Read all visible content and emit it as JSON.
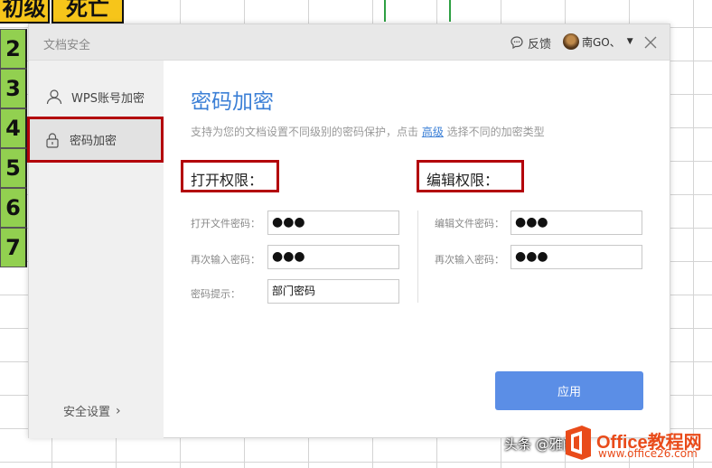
{
  "sheet": {
    "top_cells": [
      "初级",
      "死亡"
    ],
    "row_numbers": [
      "2",
      "3",
      "4",
      "5",
      "6",
      "7"
    ]
  },
  "dialog": {
    "title": "文档安全",
    "feedback_label": "反馈",
    "user_name": "南GO、",
    "close_icon": "close-icon"
  },
  "sidebar": {
    "items": [
      {
        "label": "WPS账号加密",
        "icon": "user-icon",
        "active": false
      },
      {
        "label": "密码加密",
        "icon": "lock-icon",
        "active": true
      }
    ],
    "security_settings": "安全设置"
  },
  "main": {
    "title": "密码加密",
    "description_prefix": "支持为您的文档设置不同级别的密码保护，点击 ",
    "description_link": "高级",
    "description_suffix": " 选择不同的加密类型",
    "open_permission": {
      "title": "打开权限：",
      "fields": [
        {
          "label": "打开文件密码：",
          "value": "●●●"
        },
        {
          "label": "再次输入密码：",
          "value": "●●●"
        },
        {
          "label": "密码提示：",
          "value": "部门密码"
        }
      ]
    },
    "edit_permission": {
      "title": "编辑权限：",
      "fields": [
        {
          "label": "编辑文件密码：",
          "value": "●●●"
        },
        {
          "label": "再次输入密码：",
          "value": "●●●"
        }
      ]
    },
    "apply_label": "应用"
  },
  "watermark": {
    "brand": "Office教程网",
    "url": "www.office26.com",
    "handle": "头条 @雅阁"
  },
  "colors": {
    "accent": "#3b7fd6",
    "button": "#5b8ee6",
    "highlight_box": "#b3000a",
    "row_header": "#92d050",
    "top_cell": "#f6c51a"
  }
}
